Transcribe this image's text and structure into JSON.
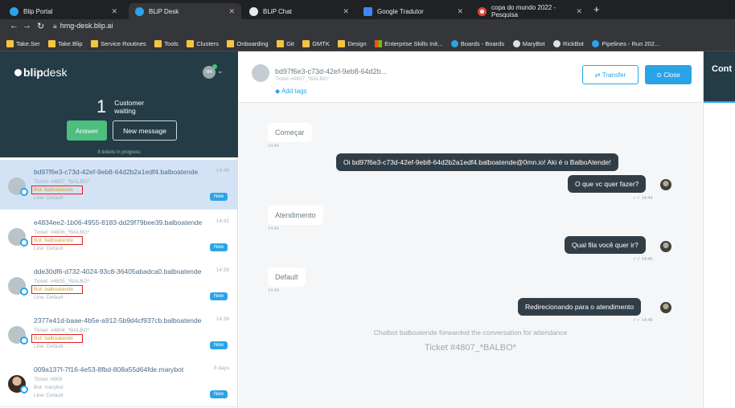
{
  "browser": {
    "tabs": [
      {
        "label": "Blip Portal",
        "active": false
      },
      {
        "label": "BLiP Desk",
        "active": true
      },
      {
        "label": "BLiP Chat",
        "active": false
      },
      {
        "label": "Google Tradutor",
        "active": false
      },
      {
        "label": "copa do mundo 2022 - Pesquisa",
        "active": false
      }
    ],
    "url": "hmg-desk.blip.ai",
    "bookmarks": [
      "Take.Ser",
      "Take.Blip",
      "Service Routines",
      "Tools",
      "Clusters",
      "Onboarding",
      "Git",
      "GMTK",
      "Design",
      "Enterprise Skills Init...",
      "Boards - Boards",
      "MaryBot",
      "RickBot",
      "Pipelines - Run 202..."
    ]
  },
  "sidebar": {
    "logo_bold": "blip",
    "logo_light": "desk",
    "user_initials": "MR",
    "waiting_count": "1",
    "waiting_label_1": "Customer",
    "waiting_label_2": "waiting",
    "answer_label": "Answer",
    "new_message_label": "New message",
    "progress_label": "8 tickets in progress",
    "tickets": [
      {
        "title": "bd97f6e3-c73d-42ef-9eb8-64d2b2a1edf4.balboatende",
        "time": "14:48",
        "ticket": "Ticket: #4807_*BALBO*",
        "bot": "Bot: balboatende",
        "line": "Line: Default",
        "badge": "New"
      },
      {
        "title": "e4834ee2-1b06-4955-8183-dd29f79bee39.balboatende",
        "time": "14:42",
        "ticket": "Ticket: #4806_*BALBO*",
        "bot": "Bot: balboatende",
        "line": "Line: Default",
        "badge": "New"
      },
      {
        "title": "dde30df6-d732-4024-93c8-36405abadca0.balboatende",
        "time": "14:39",
        "ticket": "Ticket: #4805_*BALBO*",
        "bot": "Bot: balboatende",
        "line": "Line: Default",
        "badge": "New"
      },
      {
        "title": "2377e41d-baae-4b5e-a912-5b9d4cf937cb.balboatende",
        "time": "14:39",
        "ticket": "Ticket: #4804_*BALBO*",
        "bot": "Bot: balboatende",
        "line": "Line: Default",
        "badge": "New"
      },
      {
        "title": "009a137f-7f16-4e53-8fbd-808a55d64fde.marybot",
        "time": "8 days",
        "ticket": "Ticket: #609",
        "bot": "Bot: marybot",
        "line": "Line: Default",
        "badge": "New"
      }
    ]
  },
  "chat": {
    "title": "bd97f6e3-c73d-42ef-9eb8-64d2b...",
    "subtitle": "Ticket #4807_*BALBO*",
    "add_tags": "Add tags",
    "transfer_label": "Transfer",
    "close_label": "Close",
    "messages": [
      {
        "dir": "in",
        "text": "Começar",
        "time": "14:44"
      },
      {
        "dir": "out",
        "text": "Oi bd97f6e3-c73d-42ef-9eb8-64d2b2a1edf4.balboatende@0mn.io! Aki é o BalboAtende!",
        "time": ""
      },
      {
        "dir": "out",
        "text": "O que vc quer fazer?",
        "time": "14:44"
      },
      {
        "dir": "in",
        "text": "Atendimento",
        "time": "14:46"
      },
      {
        "dir": "out",
        "text": "Qual fila você quer ir?",
        "time": "14:46"
      },
      {
        "dir": "in",
        "text": "Default",
        "time": "14:48"
      },
      {
        "dir": "out",
        "text": "Redirecionando para o atendimento",
        "time": "14:48"
      }
    ],
    "forward_note": "Chatbot balboatende forwarded the conversation for attendance",
    "ticket_note": "Ticket #4807_*BALBO*"
  },
  "right": {
    "header": "Cont"
  }
}
